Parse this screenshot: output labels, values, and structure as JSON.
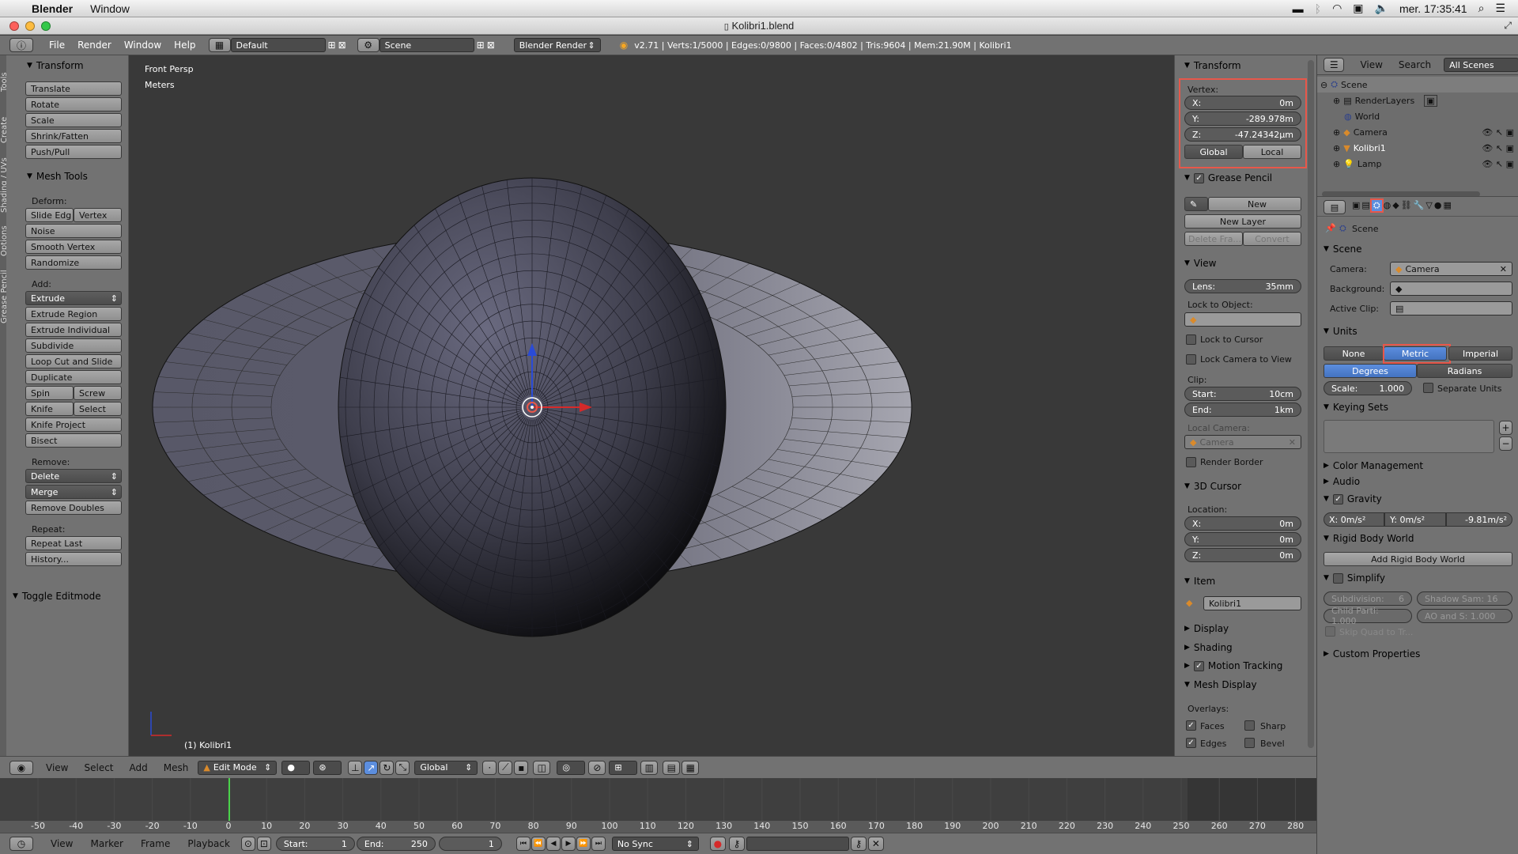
{
  "mac": {
    "app": "Blender",
    "menu_window": "Window",
    "clock": "mer. 17:35:41"
  },
  "window": {
    "title": "Kolibri1.blend"
  },
  "topbar": {
    "menus": [
      "File",
      "Render",
      "Window",
      "Help"
    ],
    "layout": "Default",
    "scene": "Scene",
    "engine": "Blender Render",
    "stats": "v2.71 | Verts:1/5000 | Edges:0/9800 | Faces:0/4802 | Tris:9604 | Mem:21.90M | Kolibri1"
  },
  "toolshelf": {
    "tabs": [
      "Tools",
      "Create",
      "Shading / UVs",
      "Options",
      "Grease Pencil"
    ],
    "transform_title": "Transform",
    "transform": [
      "Translate",
      "Rotate",
      "Scale",
      "Shrink/Fatten",
      "Push/Pull"
    ],
    "meshtools_title": "Mesh Tools",
    "deform_label": "Deform:",
    "slide_edge": "Slide Edg",
    "vertex": "Vertex",
    "noise": "Noise",
    "smooth_vertex": "Smooth Vertex",
    "randomize": "Randomize",
    "add_label": "Add:",
    "extrude": "Extrude",
    "extrude_region": "Extrude Region",
    "extrude_individual": "Extrude Individual",
    "subdivide": "Subdivide",
    "loopcut": "Loop Cut and Slide",
    "duplicate": "Duplicate",
    "spin": "Spin",
    "screw": "Screw",
    "knife": "Knife",
    "select": "Select",
    "knife_project": "Knife Project",
    "bisect": "Bisect",
    "remove_label": "Remove:",
    "delete": "Delete",
    "merge": "Merge",
    "remove_doubles": "Remove Doubles",
    "repeat_label": "Repeat:",
    "repeat_last": "Repeat Last",
    "history": "History...",
    "toggle_editmode": "Toggle Editmode"
  },
  "viewport": {
    "view_name": "Front Persp",
    "units": "Meters",
    "object_label": "(1) Kolibri1"
  },
  "npanel": {
    "transform_title": "Transform",
    "vertex_label": "Vertex:",
    "x_label": "X:",
    "x_val": "0m",
    "y_label": "Y:",
    "y_val": "-289.978m",
    "z_label": "Z:",
    "z_val": "-47.24342μm",
    "global": "Global",
    "local": "Local",
    "grease_title": "Grease Pencil",
    "new": "New",
    "new_layer": "New Layer",
    "delete_frame": "Delete Fra...",
    "convert": "Convert",
    "view_title": "View",
    "lens_label": "Lens:",
    "lens_val": "35mm",
    "lock_object": "Lock to Object:",
    "lock_cursor": "Lock to Cursor",
    "lock_camera": "Lock Camera to View",
    "clip_label": "Clip:",
    "start_label": "Start:",
    "start_val": "10cm",
    "end_label": "End:",
    "end_val": "1km",
    "local_camera": "Local Camera:",
    "camera": "Camera",
    "render_border": "Render Border",
    "cursor_title": "3D Cursor",
    "location": "Location:",
    "cx_label": "X:",
    "cx": "0m",
    "cy_label": "Y:",
    "cy": "0m",
    "cz_label": "Z:",
    "cz": "0m",
    "item_title": "Item",
    "item_name": "Kolibri1",
    "display": "Display",
    "shading": "Shading",
    "motion_tracking": "Motion Tracking",
    "mesh_display": "Mesh Display",
    "overlays": "Overlays:",
    "faces": "Faces",
    "sharp": "Sharp",
    "edges": "Edges",
    "bevel": "Bevel"
  },
  "outliner": {
    "view": "View",
    "search": "Search",
    "all_scenes": "All Scenes",
    "items": [
      "Scene",
      "RenderLayers",
      "World",
      "Camera",
      "Kolibri1",
      "Lamp"
    ]
  },
  "properties": {
    "scene_path": "Scene",
    "scene_title": "Scene",
    "camera_label": "Camera:",
    "camera_val": "Camera",
    "background_label": "Background:",
    "active_clip_label": "Active Clip:",
    "units_title": "Units",
    "none": "None",
    "metric": "Metric",
    "imperial": "Imperial",
    "degrees": "Degrees",
    "radians": "Radians",
    "scale_label": "Scale:",
    "scale_val": "1.000",
    "separate_units": "Separate Units",
    "keying_title": "Keying Sets",
    "color_mgmt": "Color Management",
    "audio": "Audio",
    "gravity": "Gravity",
    "gx": "X:  0m/s²",
    "gy": "Y:  0m/s²",
    "gz": "-9.81m/s²",
    "rigid_title": "Rigid Body World",
    "add_rigid": "Add Rigid Body World",
    "simplify": "Simplify",
    "subdivision": "Subdivision:",
    "subdivision_val": "6",
    "shadow": "Shadow Sam: 16",
    "child": "Child Parti: 1.000",
    "ao": "AO and S:  1.000",
    "skip_quad": "Skip Quad to Tr...",
    "custom_props": "Custom Properties"
  },
  "viewheader": {
    "view": "View",
    "select": "Select",
    "add": "Add",
    "mesh": "Mesh",
    "mode": "Edit Mode",
    "orientation": "Global"
  },
  "timeline": {
    "ticks": [
      "-50",
      "-40",
      "-30",
      "-20",
      "-10",
      "0",
      "10",
      "20",
      "30",
      "40",
      "50",
      "60",
      "70",
      "80",
      "90",
      "100",
      "110",
      "120",
      "130",
      "140",
      "150",
      "160",
      "170",
      "180",
      "190",
      "200",
      "210",
      "220",
      "230",
      "240",
      "250",
      "260",
      "270",
      "280"
    ],
    "view": "View",
    "marker": "Marker",
    "frame": "Frame",
    "playback": "Playback",
    "start_label": "Start:",
    "start": "1",
    "end_label": "End:",
    "end": "250",
    "current": "1",
    "sync": "No Sync"
  },
  "colors": {
    "highlight": "#e8574a",
    "blue": "#5c8ede"
  }
}
